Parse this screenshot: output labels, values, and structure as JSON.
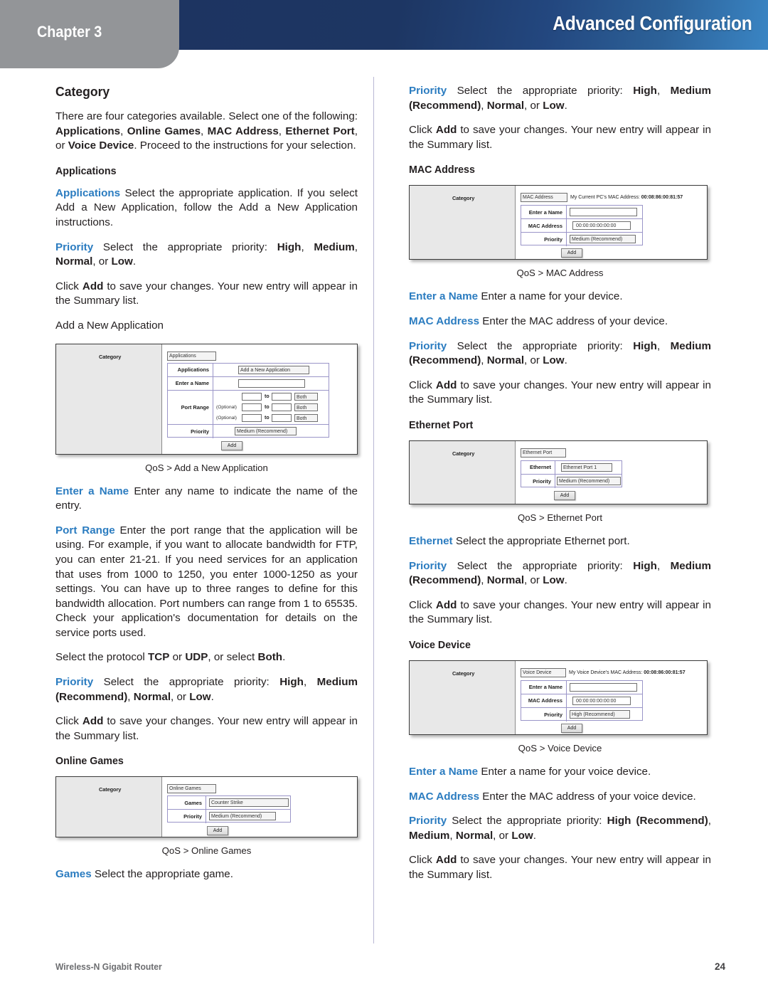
{
  "header": {
    "chapter_label": "Chapter 3",
    "title": "Advanced Configuration"
  },
  "footer": {
    "product": "Wireless-N Gigabit Router",
    "page_number": "24"
  },
  "left_column": {
    "section_title": "Category",
    "intro_para": "There are four categories available. Select one of the following: Applications, Online Games, MAC Address, Ethernet Port, or Voice Device. Proceed to the instructions for your selection.",
    "applications_heading": "Applications",
    "applications_term": "Applications",
    "applications_desc": "Select the appropriate application. If you select Add a New Application, follow the Add a New Application instructions.",
    "priority_term": "Priority",
    "priority_desc_lead": "Select the appropriate priority:",
    "priority_high": "High",
    "priority_medium": "Medium",
    "priority_normal": "Normal",
    "priority_low": "Low",
    "priority_or": ", or ",
    "click_add_lead": "Click ",
    "click_add_bold": "Add",
    "click_add_rest": " to save your changes. Your new entry will appear in the Summary list.",
    "add_new_application_label": "Add a New Application",
    "enter_name_term": "Enter a Name",
    "enter_name_desc": "Enter any name to indicate the name of the entry.",
    "port_range_term": "Port Range",
    "port_range_desc": "Enter the port range that the application will be using. For example, if you want to allocate bandwidth for FTP, you can enter 21-21. If you need services for an application that uses from 1000 to 1250, you enter 1000-1250 as your settings. You can have up to three ranges to define for this bandwidth allocation. Port numbers can range from 1 to 65535. Check your application's documentation for details on the service ports used.",
    "protocol_lead": "Select the protocol ",
    "protocol_tcp": "TCP",
    "protocol_or1": " or ",
    "protocol_udp": "UDP",
    "protocol_or2": ", or select ",
    "protocol_both": "Both",
    "protocol_end": ".",
    "priority2_recommend": "(Recommend)",
    "online_games_heading": "Online Games",
    "games_term": "Games",
    "games_desc": "Select the appropriate game."
  },
  "right_column": {
    "mac_address_heading": "MAC Address",
    "ethernet_port_heading": "Ethernet Port",
    "voice_device_heading": "Voice Device",
    "priority_term": "Priority",
    "priority_desc_lead": "Select the appropriate priority:",
    "priority_high": "High",
    "priority_medium": "Medium",
    "priority_recommend": "(Recommend)",
    "priority_normal": "Normal",
    "priority_low": "Low",
    "click_add_lead": "Click ",
    "click_add_bold": "Add",
    "click_add_rest": " to save your changes. Your new entry will appear in the Summary list.",
    "enter_name_term": "Enter a Name",
    "enter_name_desc_device": "Enter a name for your device.",
    "enter_name_desc_voice": "Enter a name for your voice device.",
    "mac_term": "MAC Address",
    "mac_desc_device": "Enter the MAC address of your device.",
    "mac_desc_voice": "Enter the MAC address of your voice device.",
    "ethernet_term": "Ethernet",
    "ethernet_desc": "Select the appropriate Ethernet port."
  },
  "figures": {
    "applications": {
      "caption": "QoS > Add a New Application",
      "category_label": "Category",
      "category_value": "Applications",
      "rows": [
        {
          "label": "Applications",
          "value": "Add a New Application",
          "type": "select"
        },
        {
          "label": "Enter a Name",
          "value": "",
          "type": "text"
        },
        {
          "label": "Port Range",
          "value": "",
          "type": "portrange"
        },
        {
          "label": "Priority",
          "value": "Medium (Recommend)",
          "type": "select"
        }
      ],
      "port_rows": [
        {
          "optional": "",
          "from": "",
          "to_label": "to",
          "to": "",
          "protocol": "Both"
        },
        {
          "optional": "(Optional)",
          "from": "",
          "to_label": "to",
          "to": "",
          "protocol": "Both"
        },
        {
          "optional": "(Optional)",
          "from": "",
          "to_label": "to",
          "to": "",
          "protocol": "Both"
        }
      ],
      "add_button": "Add"
    },
    "online_games": {
      "caption": "QoS > Online Games",
      "category_label": "Category",
      "category_value": "Online Games",
      "rows": [
        {
          "label": "Games",
          "value": "Counter Strike",
          "type": "select"
        },
        {
          "label": "Priority",
          "value": "Medium (Recommend)",
          "type": "select"
        }
      ],
      "add_button": "Add"
    },
    "mac_address": {
      "caption": "QoS > MAC Address",
      "category_label": "Category",
      "category_value": "MAC Address",
      "note_prefix": "My Current PC's MAC Address:",
      "note_value": "00:08:86:00:81:57",
      "rows": [
        {
          "label": "Enter a Name",
          "value": "",
          "type": "text"
        },
        {
          "label": "MAC Address",
          "value": "00:00:00:00:00:00",
          "type": "text"
        },
        {
          "label": "Priority",
          "value": "Medium (Recommend)",
          "type": "select"
        }
      ],
      "add_button": "Add"
    },
    "ethernet_port": {
      "caption": "QoS > Ethernet Port",
      "category_label": "Category",
      "category_value": "Ethernet Port",
      "rows": [
        {
          "label": "Ethernet",
          "value": "Ethernet Port 1",
          "type": "select"
        },
        {
          "label": "Priority",
          "value": "Medium (Recommend)",
          "type": "select"
        }
      ],
      "add_button": "Add"
    },
    "voice_device": {
      "caption": "QoS > Voice Device",
      "category_label": "Category",
      "category_value": "Voice Device",
      "note_prefix": "My Voice Device's MAC Address:",
      "note_value": "00:08:86:00:81:57",
      "rows": [
        {
          "label": "Enter a Name",
          "value": "",
          "type": "text"
        },
        {
          "label": "MAC Address",
          "value": "00:00:00:00:00:00",
          "type": "text"
        },
        {
          "label": "Priority",
          "value": "High (Recommend)",
          "type": "select"
        }
      ],
      "add_button": "Add"
    }
  },
  "colors": {
    "header_navy": "#1d3461",
    "header_light_blue": "#3a85c4",
    "chapter_gray": "#939598",
    "term_blue": "#2b7cc0",
    "body_text": "#231f20"
  }
}
